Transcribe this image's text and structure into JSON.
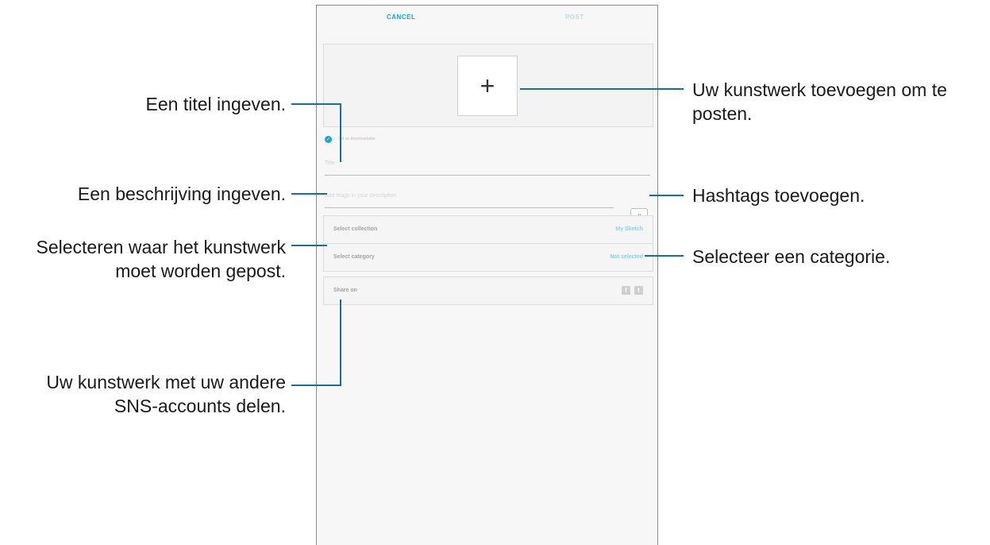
{
  "screen": {
    "topbar": {
      "cancel": "CANCEL",
      "post": "POST"
    },
    "add_icon": "+",
    "downloadable_label": "Set as downloadable",
    "title_placeholder": "Title",
    "description_placeholder": "Add #tags in your description",
    "hashtag_button": "#",
    "select_collection": {
      "label": "Select collection",
      "value": "My Sketch"
    },
    "select_category": {
      "label": "Select category",
      "value": "Not selected"
    },
    "share_on": {
      "label": "Share on",
      "icons": [
        "facebook-icon",
        "twitter-icon"
      ]
    }
  },
  "callouts": {
    "title": "Een titel ingeven.",
    "description": "Een beschrijving ingeven.",
    "collection_line1": "Selecteren waar het kunstwerk",
    "collection_line2": "moet worden gepost.",
    "share_line1": "Uw kunstwerk met uw andere",
    "share_line2": "SNS-accounts delen.",
    "add_line1": "Uw kunstwerk toevoegen om te",
    "add_line2": "posten.",
    "hashtags": "Hashtags toevoegen.",
    "category": "Selecteer een categorie."
  },
  "colors": {
    "accent": "#1ca4c9",
    "callout_line": "#1a6d94"
  }
}
